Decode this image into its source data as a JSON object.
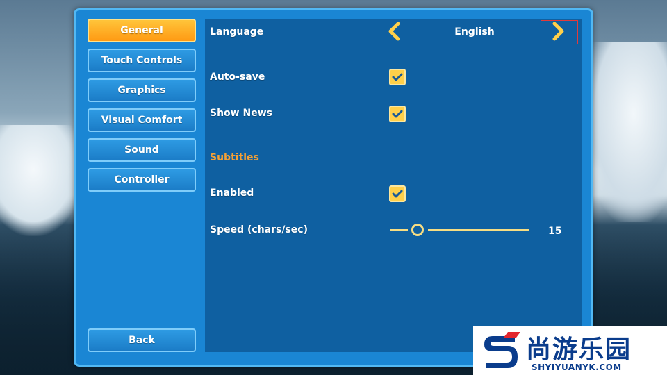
{
  "nav": {
    "items": [
      {
        "label": "General",
        "active": true
      },
      {
        "label": "Touch Controls",
        "active": false
      },
      {
        "label": "Graphics",
        "active": false
      },
      {
        "label": "Visual Comfort",
        "active": false
      },
      {
        "label": "Sound",
        "active": false
      },
      {
        "label": "Controller",
        "active": false
      }
    ],
    "back_label": "Back"
  },
  "settings": {
    "language": {
      "label": "Language",
      "value": "English",
      "prev_icon": "chevron-left-icon",
      "next_icon": "chevron-right-icon"
    },
    "autosave": {
      "label": "Auto-save",
      "checked": true
    },
    "show_news": {
      "label": "Show News",
      "checked": true
    },
    "subtitles": {
      "title": "Subtitles",
      "enabled": {
        "label": "Enabled",
        "checked": true
      },
      "speed": {
        "label": "Speed (chars/sec)",
        "value": "15",
        "fraction": 0.2
      }
    }
  },
  "watermark": {
    "cn_text": "尚游乐园",
    "url": "SHYIYUANYK.COM"
  },
  "colors": {
    "panel": "#1a86d4",
    "content": "#0f60a1",
    "active_tab": "#ff9a13",
    "accent_yellow": "#ffd04a",
    "section_title": "#f5a035"
  }
}
